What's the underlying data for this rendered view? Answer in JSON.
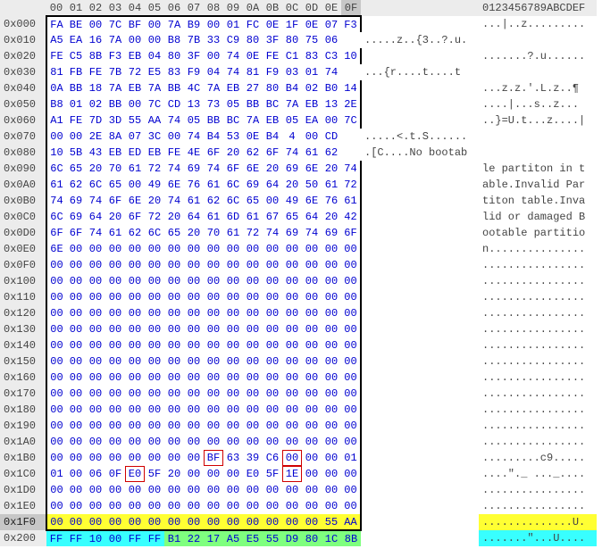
{
  "header_cols": [
    "00",
    "01",
    "02",
    "03",
    "04",
    "05",
    "06",
    "07",
    "08",
    "09",
    "0A",
    "0B",
    "0C",
    "0D",
    "0E",
    "0F"
  ],
  "header_ascii": "0123456789ABCDEF",
  "current_col_index": 15,
  "current_row_offset": "0x1F0",
  "rows": [
    {
      "offset": "0x000",
      "hex": [
        "FA",
        "BE",
        "00",
        "7C",
        "BF",
        "00",
        "7A",
        "B9",
        "00",
        "01",
        "FC",
        "0E",
        "1F",
        "0E",
        "07",
        "F3"
      ],
      "ascii": "...|..z........."
    },
    {
      "offset": "0x010",
      "hex": [
        "A5",
        "EA",
        "16",
        "7A",
        "00",
        "00",
        "B8",
        "7B",
        "33",
        "C9",
        "80",
        "3F",
        "80",
        "75",
        "06"
      ],
      "ascii": ".....z..{3..?.u."
    },
    {
      "offset": "0x020",
      "hex": [
        "FE",
        "C5",
        "8B",
        "F3",
        "EB",
        "04",
        "80",
        "3F",
        "00",
        "74",
        "0E",
        "FE",
        "C1",
        "83",
        "C3",
        "10"
      ],
      "ascii": ".......?.u......"
    },
    {
      "offset": "0x030",
      "hex": [
        "81",
        "FB",
        "FE",
        "7B",
        "72",
        "E5",
        "83",
        "F9",
        "04",
        "74",
        "81",
        "F9",
        "03",
        "01",
        "74"
      ],
      "ascii": "...{r....t....t"
    },
    {
      "offset": "0x040",
      "hex": [
        "0A",
        "BB",
        "18",
        "7A",
        "EB",
        "7A",
        "BB",
        "4C",
        "7A",
        "EB",
        "27",
        "80",
        "B4",
        "02",
        "B0",
        "14"
      ],
      "ascii": "...z.z.'.L.z..¶"
    },
    {
      "offset": "0x050",
      "hex": [
        "B8",
        "01",
        "02",
        "BB",
        "00",
        "7C",
        "CD",
        "13",
        "73",
        "05",
        "BB",
        "BC",
        "7A",
        "EB",
        "13",
        "2E"
      ],
      "ascii": "....|...s..z..."
    },
    {
      "offset": "0x060",
      "hex": [
        "A1",
        "FE",
        "7D",
        "3D",
        "55",
        "AA",
        "74",
        "05",
        "BB",
        "BC",
        "7A",
        "EB",
        "05",
        "EA",
        "00",
        "7C"
      ],
      "ascii": "..}=U.t...z....|"
    },
    {
      "offset": "0x070",
      "hex": [
        "00",
        "00",
        "2E",
        "8A",
        "07",
        "3C",
        "00",
        "74",
        "B4",
        "53",
        "0E",
        "B4",
        "4",
        "00",
        "CD"
      ],
      "ascii": ".....<.t.S......"
    },
    {
      "offset": "0x080",
      "hex": [
        "10",
        "5B",
        "43",
        "EB",
        "ED",
        "EB",
        "FE",
        "4E",
        "6F",
        "20",
        "62",
        "6F",
        "74",
        "61",
        "62"
      ],
      "ascii": ".[C....No bootab"
    },
    {
      "offset": "0x090",
      "hex": [
        "6C",
        "65",
        "20",
        "70",
        "61",
        "72",
        "74",
        "69",
        "74",
        "6F",
        "6E",
        "20",
        "69",
        "6E",
        "20",
        "74"
      ],
      "ascii": "le partiton in t"
    },
    {
      "offset": "0x0A0",
      "hex": [
        "61",
        "62",
        "6C",
        "65",
        "00",
        "49",
        "6E",
        "76",
        "61",
        "6C",
        "69",
        "64",
        "20",
        "50",
        "61",
        "72"
      ],
      "ascii": "able.Invalid Par"
    },
    {
      "offset": "0x0B0",
      "hex": [
        "74",
        "69",
        "74",
        "6F",
        "6E",
        "20",
        "74",
        "61",
        "62",
        "6C",
        "65",
        "00",
        "49",
        "6E",
        "76",
        "61"
      ],
      "ascii": "titon table.Inva"
    },
    {
      "offset": "0x0C0",
      "hex": [
        "6C",
        "69",
        "64",
        "20",
        "6F",
        "72",
        "20",
        "64",
        "61",
        "6D",
        "61",
        "67",
        "65",
        "64",
        "20",
        "42"
      ],
      "ascii": "lid or damaged B"
    },
    {
      "offset": "0x0D0",
      "hex": [
        "6F",
        "6F",
        "74",
        "61",
        "62",
        "6C",
        "65",
        "20",
        "70",
        "61",
        "72",
        "74",
        "69",
        "74",
        "69",
        "6F"
      ],
      "ascii": "ootable partitio"
    },
    {
      "offset": "0x0E0",
      "hex": [
        "6E",
        "00",
        "00",
        "00",
        "00",
        "00",
        "00",
        "00",
        "00",
        "00",
        "00",
        "00",
        "00",
        "00",
        "00",
        "00"
      ],
      "ascii": "n..............."
    },
    {
      "offset": "0x0F0",
      "hex": [
        "00",
        "00",
        "00",
        "00",
        "00",
        "00",
        "00",
        "00",
        "00",
        "00",
        "00",
        "00",
        "00",
        "00",
        "00",
        "00"
      ],
      "ascii": "................"
    },
    {
      "offset": "0x100",
      "hex": [
        "00",
        "00",
        "00",
        "00",
        "00",
        "00",
        "00",
        "00",
        "00",
        "00",
        "00",
        "00",
        "00",
        "00",
        "00",
        "00"
      ],
      "ascii": "................"
    },
    {
      "offset": "0x110",
      "hex": [
        "00",
        "00",
        "00",
        "00",
        "00",
        "00",
        "00",
        "00",
        "00",
        "00",
        "00",
        "00",
        "00",
        "00",
        "00",
        "00"
      ],
      "ascii": "................"
    },
    {
      "offset": "0x120",
      "hex": [
        "00",
        "00",
        "00",
        "00",
        "00",
        "00",
        "00",
        "00",
        "00",
        "00",
        "00",
        "00",
        "00",
        "00",
        "00",
        "00"
      ],
      "ascii": "................"
    },
    {
      "offset": "0x130",
      "hex": [
        "00",
        "00",
        "00",
        "00",
        "00",
        "00",
        "00",
        "00",
        "00",
        "00",
        "00",
        "00",
        "00",
        "00",
        "00",
        "00"
      ],
      "ascii": "................"
    },
    {
      "offset": "0x140",
      "hex": [
        "00",
        "00",
        "00",
        "00",
        "00",
        "00",
        "00",
        "00",
        "00",
        "00",
        "00",
        "00",
        "00",
        "00",
        "00",
        "00"
      ],
      "ascii": "................"
    },
    {
      "offset": "0x150",
      "hex": [
        "00",
        "00",
        "00",
        "00",
        "00",
        "00",
        "00",
        "00",
        "00",
        "00",
        "00",
        "00",
        "00",
        "00",
        "00",
        "00"
      ],
      "ascii": "................"
    },
    {
      "offset": "0x160",
      "hex": [
        "00",
        "00",
        "00",
        "00",
        "00",
        "00",
        "00",
        "00",
        "00",
        "00",
        "00",
        "00",
        "00",
        "00",
        "00",
        "00"
      ],
      "ascii": "................"
    },
    {
      "offset": "0x170",
      "hex": [
        "00",
        "00",
        "00",
        "00",
        "00",
        "00",
        "00",
        "00",
        "00",
        "00",
        "00",
        "00",
        "00",
        "00",
        "00",
        "00"
      ],
      "ascii": "................"
    },
    {
      "offset": "0x180",
      "hex": [
        "00",
        "00",
        "00",
        "00",
        "00",
        "00",
        "00",
        "00",
        "00",
        "00",
        "00",
        "00",
        "00",
        "00",
        "00",
        "00"
      ],
      "ascii": "................"
    },
    {
      "offset": "0x190",
      "hex": [
        "00",
        "00",
        "00",
        "00",
        "00",
        "00",
        "00",
        "00",
        "00",
        "00",
        "00",
        "00",
        "00",
        "00",
        "00",
        "00"
      ],
      "ascii": "................"
    },
    {
      "offset": "0x1A0",
      "hex": [
        "00",
        "00",
        "00",
        "00",
        "00",
        "00",
        "00",
        "00",
        "00",
        "00",
        "00",
        "00",
        "00",
        "00",
        "00",
        "00"
      ],
      "ascii": "................"
    },
    {
      "offset": "0x1B0",
      "hex": [
        "00",
        "00",
        "00",
        "00",
        "00",
        "00",
        "00",
        "00",
        "BF",
        "63",
        "39",
        "C6",
        "00",
        "00",
        "00",
        "01"
      ],
      "ascii": ".........c9....."
    },
    {
      "offset": "0x1C0",
      "hex": [
        "01",
        "00",
        "06",
        "0F",
        "E0",
        "5F",
        "20",
        "00",
        "00",
        "00",
        "E0",
        "5F",
        "1E",
        "00",
        "00",
        "00"
      ],
      "ascii": "....\"._ ..._...."
    },
    {
      "offset": "0x1D0",
      "hex": [
        "00",
        "00",
        "00",
        "00",
        "00",
        "00",
        "00",
        "00",
        "00",
        "00",
        "00",
        "00",
        "00",
        "00",
        "00",
        "00"
      ],
      "ascii": "................"
    },
    {
      "offset": "0x1E0",
      "hex": [
        "00",
        "00",
        "00",
        "00",
        "00",
        "00",
        "00",
        "00",
        "00",
        "00",
        "00",
        "00",
        "00",
        "00",
        "00",
        "00"
      ],
      "ascii": "................"
    },
    {
      "offset": "0x1F0",
      "hex": [
        "00",
        "00",
        "00",
        "00",
        "00",
        "00",
        "00",
        "00",
        "00",
        "00",
        "00",
        "00",
        "00",
        "00",
        "55",
        "AA"
      ],
      "ascii": "..............U.",
      "hl": "yellow",
      "current": true
    },
    {
      "offset": "0x200",
      "hex": [
        "FF",
        "FF",
        "10",
        "00",
        "FF",
        "FF",
        "B1",
        "22",
        "17",
        "A5",
        "E5",
        "55",
        "D9",
        "80",
        "1C",
        "8B"
      ],
      "ascii": ".......\"...U....",
      "hl": "split",
      "no_border": true
    }
  ],
  "boxed_red": [
    {
      "row": "0x1B0",
      "cols": [
        8,
        12
      ]
    },
    {
      "row": "0x1C0",
      "cols": [
        4,
        12
      ]
    }
  ]
}
